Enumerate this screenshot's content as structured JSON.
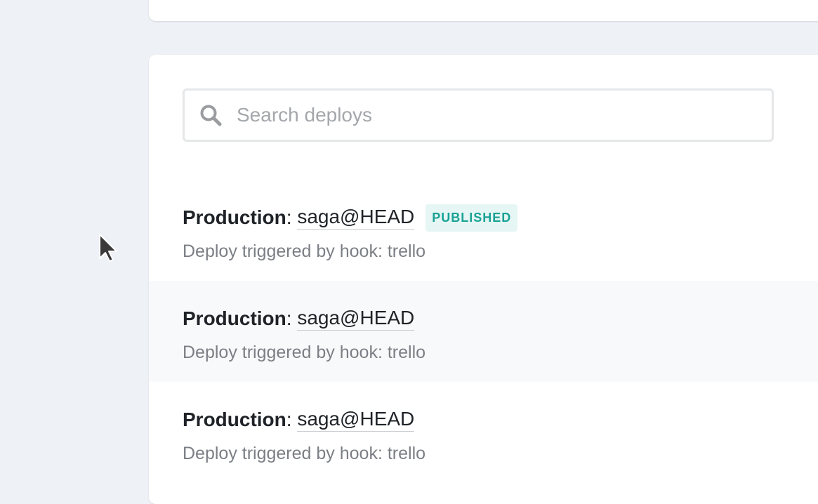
{
  "search": {
    "placeholder": "Search deploys"
  },
  "deploys": [
    {
      "context": "Production",
      "separator": ": ",
      "ref": "saga@HEAD",
      "badge": "PUBLISHED",
      "message": "Deploy triggered by hook: trello"
    },
    {
      "context": "Production",
      "separator": ": ",
      "ref": "saga@HEAD",
      "message": "Deploy triggered by hook: trello"
    },
    {
      "context": "Production",
      "separator": ": ",
      "ref": "saga@HEAD",
      "message": "Deploy triggered by hook: trello"
    }
  ],
  "colors": {
    "page_background": "#eef1f5",
    "card_background": "#ffffff",
    "badge_text": "#1aa295",
    "badge_background": "#e6f6f4",
    "subtitle_text": "#7b7f85"
  },
  "icons": {
    "search": "search-icon",
    "cursor": "mouse-pointer-icon"
  }
}
